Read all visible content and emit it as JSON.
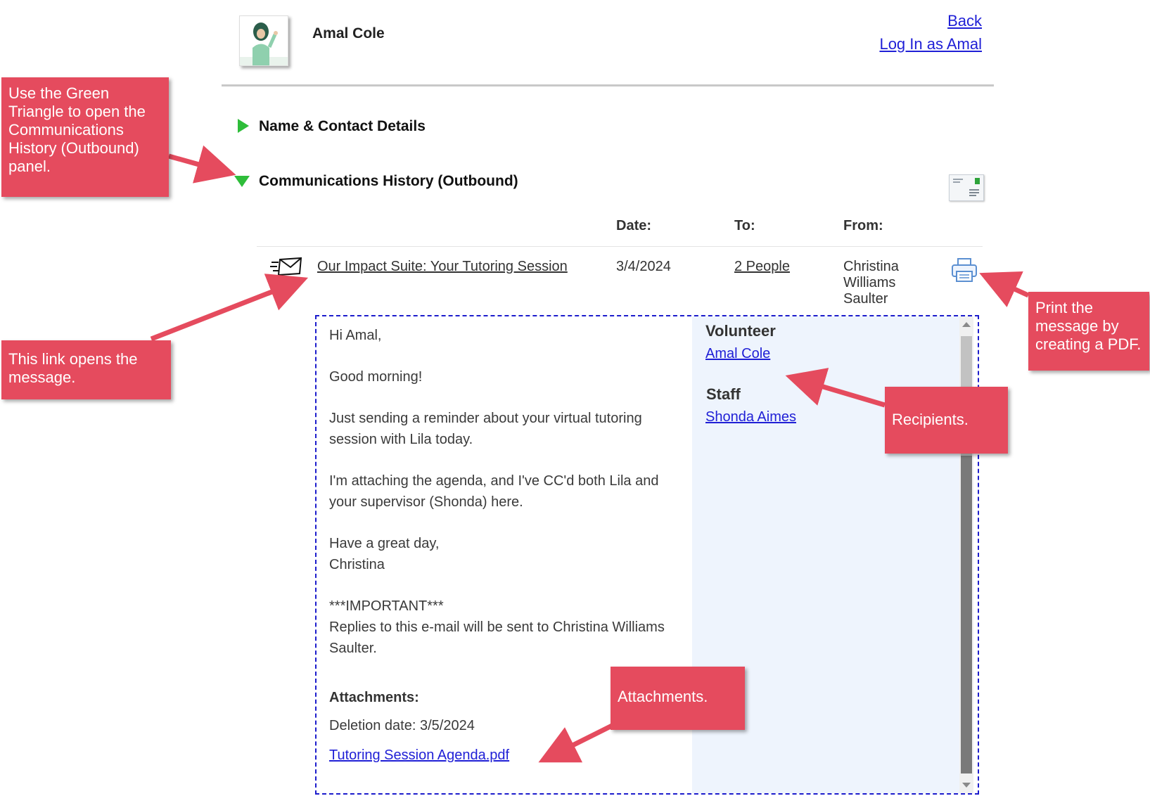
{
  "header": {
    "name": "Amal Cole",
    "back": "Back",
    "login": "Log In as Amal"
  },
  "panels": {
    "contact": "Name & Contact Details",
    "history": "Communications History (Outbound)"
  },
  "table": {
    "headers": {
      "date": "Date:",
      "to": "To:",
      "from": "From:"
    },
    "row": {
      "subject": "Our Impact Suite: Your Tutoring Session",
      "date": "3/4/2024",
      "to": "2 People",
      "from_line1": "Christina",
      "from_line2": "Williams",
      "from_line3": "Saulter"
    }
  },
  "message": {
    "greeting": "Hi Amal,",
    "p1": "Good morning!",
    "p2": "Just sending a reminder about your virtual tutoring session with Lila today.",
    "p3": "I'm attaching the agenda, and I've CC'd both Lila and your supervisor (Shonda) here.",
    "p4a": "Have a great day,",
    "p4b": "Christina",
    "p5a": "***IMPORTANT***",
    "p5b": "Replies to this e-mail will be sent to Christina Williams Saulter.",
    "attachments_label": "Attachments:",
    "deletion": "Deletion date: 3/5/2024",
    "attachment_file": "Tutoring Session Agenda.pdf"
  },
  "recipients": {
    "group1": "Volunteer",
    "person1": "Amal Cole",
    "group2": "Staff",
    "person2": "Shonda Aimes"
  },
  "annotations": {
    "triangle": "Use the Green Triangle to open the Communications History (Outbound) panel.",
    "link": "This link opens the message.",
    "print": "Print the message by creating a PDF.",
    "recipients": "Recipients.",
    "attachments": "Attachments."
  },
  "colors": {
    "annotation": "#e54b5e",
    "triangle": "#2ebd3a",
    "link": "#1f1fd6"
  },
  "icons": [
    "avatar-image",
    "mail-envelope-icon",
    "print-icon",
    "letter-icon"
  ]
}
